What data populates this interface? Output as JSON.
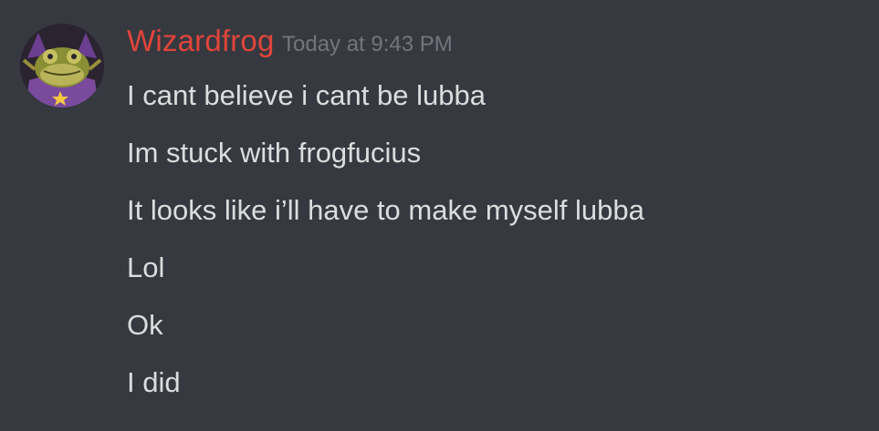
{
  "author": {
    "name": "Wizardfrog",
    "timestamp": "Today at 9:43 PM",
    "avatar_icon": "frog-wizard-avatar",
    "name_color": "#e0453b"
  },
  "messages": [
    "I cant believe i cant be lubba",
    "Im stuck with frogfucius",
    "It looks like i’ll have to make myself lubba",
    "Lol",
    "Ok",
    "I did"
  ],
  "colors": {
    "background": "#36393f",
    "message_text": "#dcddde",
    "timestamp_text": "#72767d"
  }
}
